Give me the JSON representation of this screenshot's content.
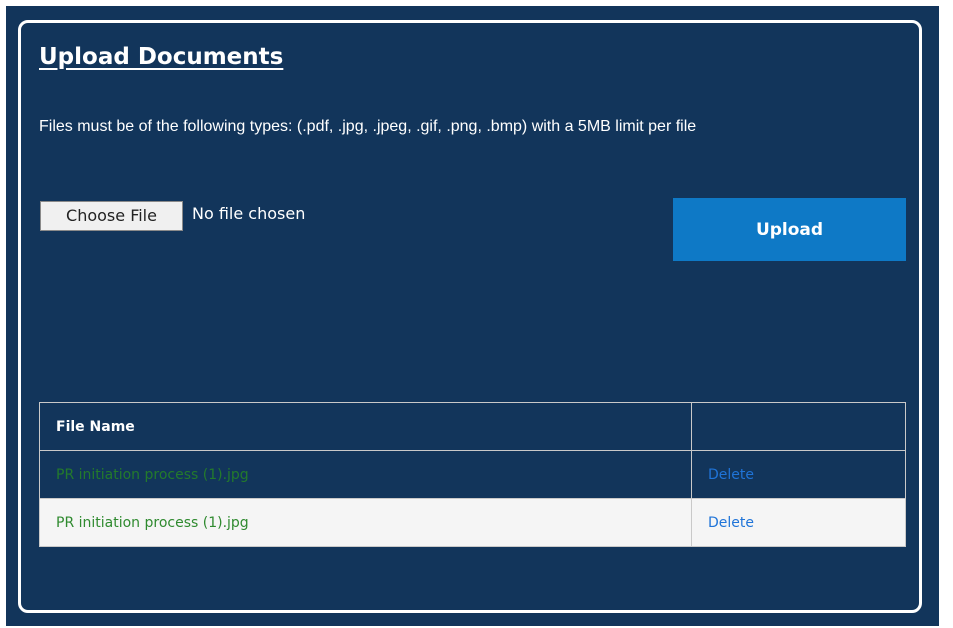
{
  "upload": {
    "title": "Upload Documents",
    "description": "Files must be of the following types: (.pdf, .jpg, .jpeg, .gif, .png, .bmp) with a 5MB limit per file",
    "choose_file_label": "Choose File",
    "file_status": "No file chosen",
    "upload_label": "Upload"
  },
  "table": {
    "headers": [
      "File Name",
      ""
    ],
    "rows": [
      {
        "file_name": "PR initiation process (1).jpg",
        "action": "Delete"
      },
      {
        "file_name": "PR initiation process (1).jpg",
        "action": "Delete"
      }
    ]
  },
  "colors": {
    "panel_background": "#12355b",
    "upload_button": "#0e79c6",
    "file_name_text": "#2f8a2f",
    "delete_link": "#1f74d8"
  }
}
